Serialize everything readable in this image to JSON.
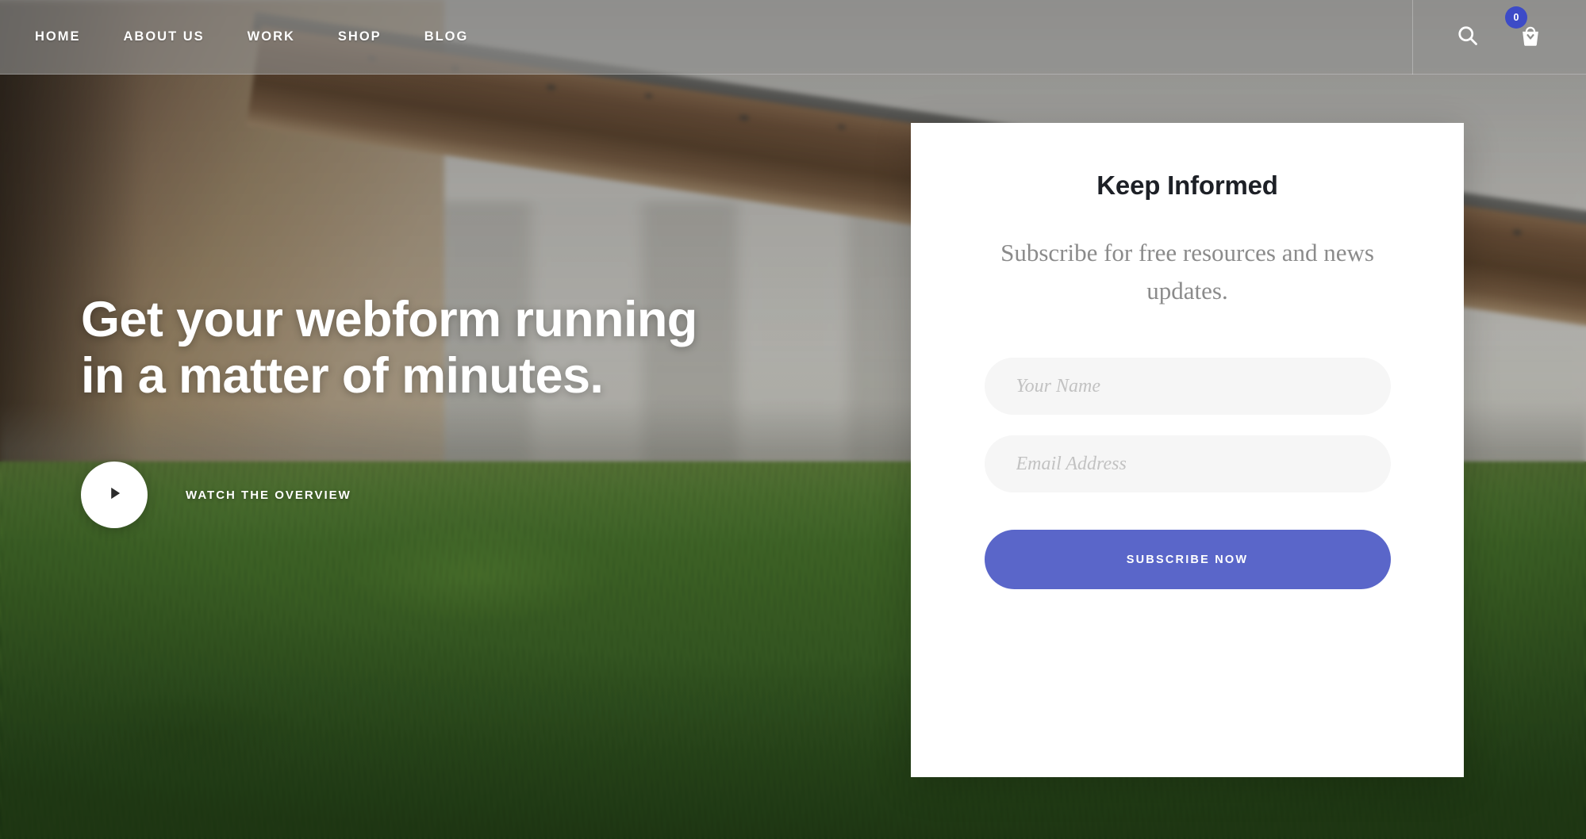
{
  "header": {
    "nav_items": [
      {
        "label": "HOME"
      },
      {
        "label": "ABOUT US"
      },
      {
        "label": "WORK"
      },
      {
        "label": "SHOP"
      },
      {
        "label": "BLOG"
      }
    ],
    "search_icon": "search-icon",
    "cart_icon": "shopping-basket-icon",
    "cart_count": "0",
    "cart_badge_color": "#3d4bc7"
  },
  "hero": {
    "heading_line_1": "Get your webform running",
    "heading_line_2": "in a matter of minutes.",
    "play_icon": "play-triangle-icon",
    "watch_label": "WATCH THE OVERVIEW",
    "text_color": "#ffffff"
  },
  "subscribe_card": {
    "title": "Keep Informed",
    "subtitle": "Subscribe for free resources and news updates.",
    "fields": [
      {
        "name": "name",
        "placeholder": "Your Name",
        "value": ""
      },
      {
        "name": "email",
        "placeholder": "Email Address",
        "value": ""
      }
    ],
    "submit_label": "SUBSCRIBE NOW",
    "accent_color": "#5a66c9",
    "background_color": "#ffffff",
    "field_background": "#f6f6f6"
  }
}
